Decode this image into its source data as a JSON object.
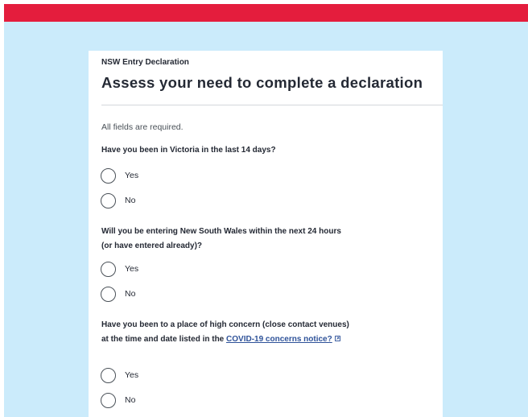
{
  "header": {
    "eyebrow": "NSW Entry Declaration",
    "title": "Assess your need to complete a declaration"
  },
  "form": {
    "required_note": "All fields are required.",
    "questions": [
      {
        "text": "Have you been in Victoria in the last 14 days?",
        "options": [
          {
            "label": "Yes",
            "selected": false
          },
          {
            "label": "No",
            "selected": false
          }
        ]
      },
      {
        "text": "Will you be entering New South Wales within the next 24 hours (or have entered already)?",
        "options": [
          {
            "label": "Yes",
            "selected": false
          },
          {
            "label": "No",
            "selected": false
          }
        ]
      },
      {
        "text_before_link": "Have you been to a place of high concern (close contact venues) at the time and date listed in the ",
        "link_text": "COVID-19 concerns notice?",
        "options": [
          {
            "label": "Yes",
            "selected": false
          },
          {
            "label": "No",
            "selected": false
          }
        ]
      }
    ]
  },
  "icons": {
    "external_link": "external-link-icon"
  },
  "colors": {
    "topbar": "#e41d3d",
    "background": "#cbebfb",
    "card": "#ffffff",
    "link": "#2e5299",
    "text": "#242934"
  }
}
